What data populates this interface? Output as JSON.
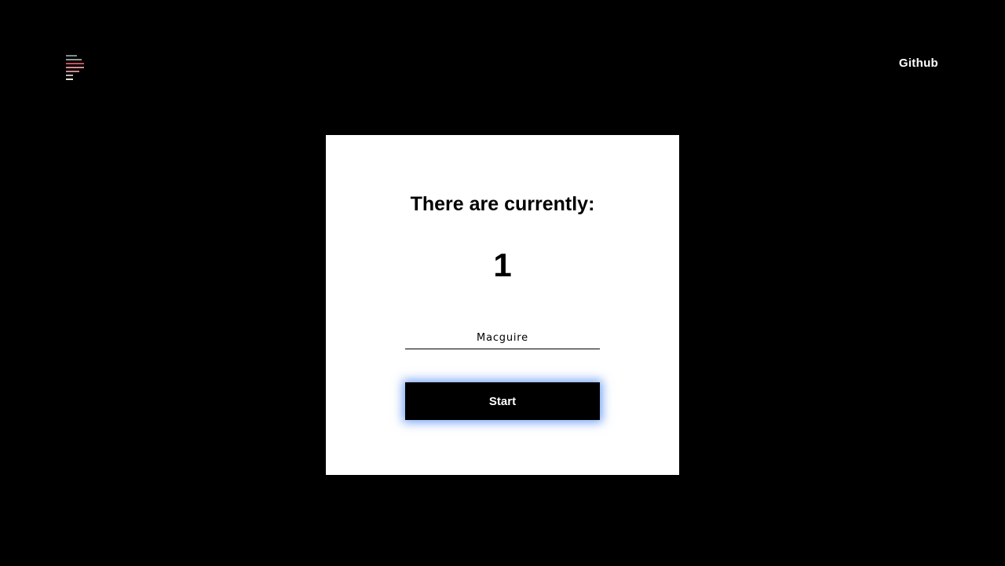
{
  "header": {
    "logo_icon": "stacked-bars-logo-icon",
    "logo_colors": [
      "#7f8c8d",
      "#8e9c8f",
      "#c0525a",
      "#d98b8f",
      "#b9b9b9",
      "#e6e6d0"
    ],
    "nav_link_label": "Github"
  },
  "card": {
    "heading": "There are currently:",
    "count": "1",
    "name_input_value": "Macguire",
    "start_button_label": "Start",
    "button_glow_color": "#4682f0"
  }
}
